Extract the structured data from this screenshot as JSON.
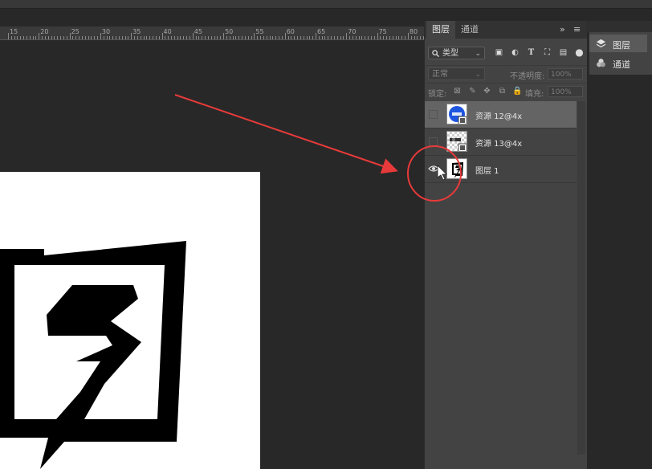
{
  "ruler": {
    "labels": [
      "15",
      "20",
      "25",
      "30",
      "35",
      "40",
      "45",
      "50",
      "55",
      "60",
      "65",
      "70",
      "75",
      "80"
    ]
  },
  "panel": {
    "tabs": [
      {
        "label": "图层",
        "active": true
      },
      {
        "label": "通道",
        "active": false
      }
    ],
    "expand_label": "»",
    "menu_label": "≡",
    "filter": {
      "kind_value": "类型",
      "kind_icon": "search-icon"
    },
    "blend": {
      "mode_value": "正常",
      "opacity_label": "不透明度:",
      "opacity_value": "100%"
    },
    "lock": {
      "label": "锁定:",
      "fill_label": "填充:",
      "fill_value": "100%"
    },
    "layers": [
      {
        "name": "资源 12@4x",
        "visible": false,
        "selected": true
      },
      {
        "name": "资源 13@4x",
        "visible": false,
        "selected": false
      },
      {
        "name": "图层 1",
        "visible": true,
        "selected": false
      }
    ]
  },
  "mini_panel": {
    "items": [
      {
        "label": "图层",
        "active": true
      },
      {
        "label": "通道",
        "active": false
      }
    ]
  },
  "colors": {
    "annotation": "#e83a3a",
    "selected_layer": "#646464",
    "panel_bg": "#434343"
  }
}
